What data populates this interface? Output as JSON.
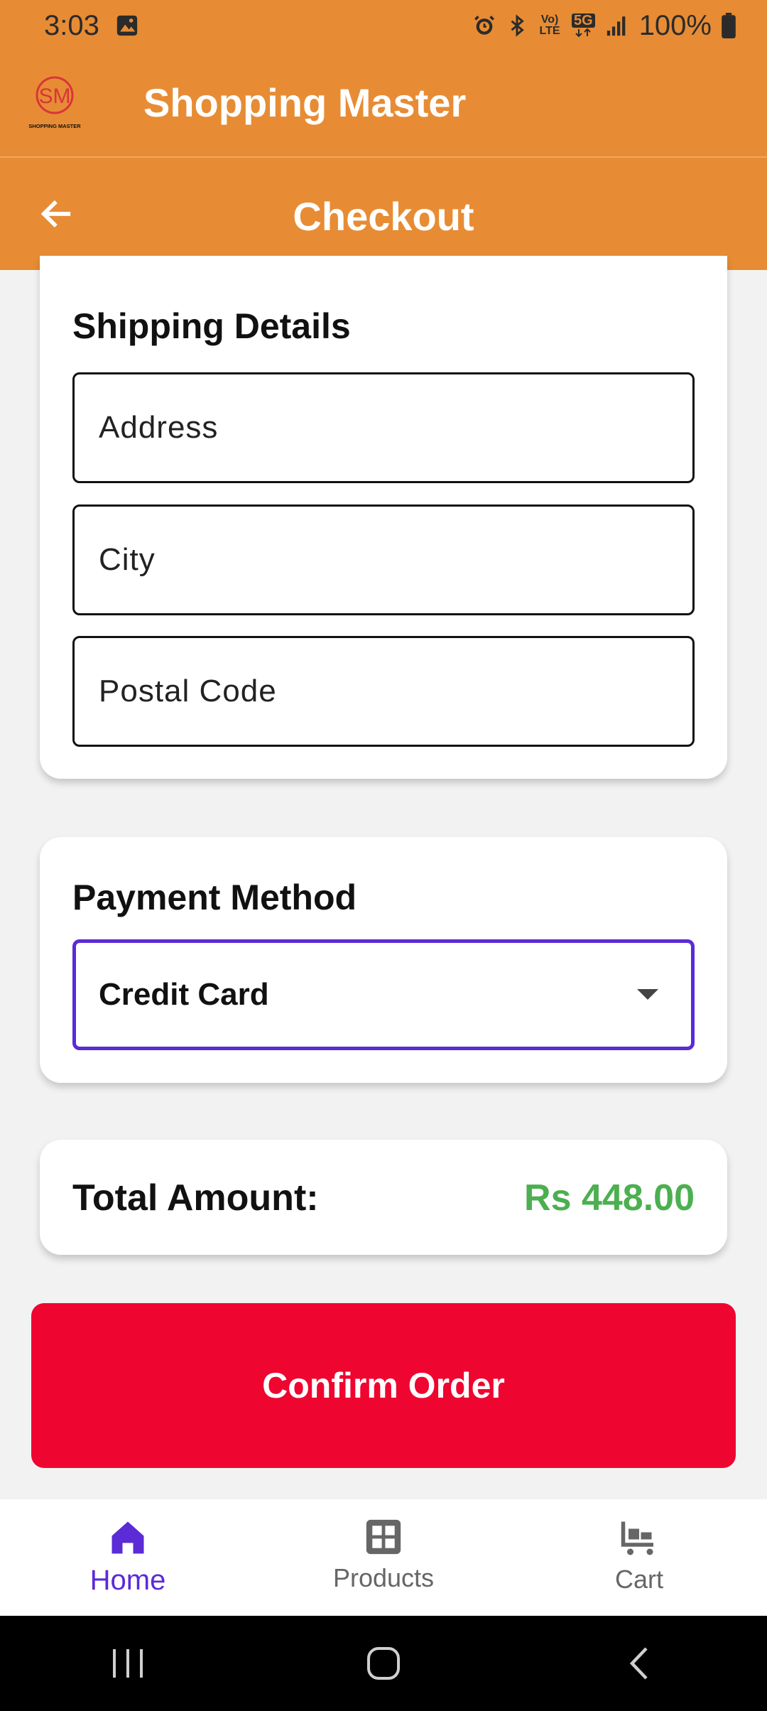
{
  "status_bar": {
    "time": "3:03",
    "battery": "100%",
    "network": "5G",
    "volte": "Vo) LTE",
    "icons": [
      "image-icon",
      "alarm-icon",
      "bluetooth-icon",
      "volte-icon",
      "5g-icon",
      "signal-icon",
      "battery-icon"
    ]
  },
  "app_bar": {
    "logo_text": "SM",
    "logo_caption": "SHOPPING MASTER",
    "title": "Shopping Master"
  },
  "checkout_bar": {
    "title": "Checkout",
    "back_icon": "arrow-left-icon"
  },
  "shipping": {
    "title": "Shipping Details",
    "address_placeholder": "Address",
    "city_placeholder": "City",
    "postal_placeholder": "Postal Code"
  },
  "payment": {
    "title": "Payment Method",
    "selected": "Credit Card",
    "dropdown_icon": "caret-down-icon"
  },
  "total": {
    "label": "Total Amount:",
    "value": "Rs 448.00",
    "value_color": "#4caf50"
  },
  "confirm": {
    "label": "Confirm Order",
    "color": "#ee0630"
  },
  "bottom_nav": {
    "items": [
      {
        "label": "Home",
        "icon": "home-icon",
        "active": true
      },
      {
        "label": "Products",
        "icon": "grid-icon",
        "active": false
      },
      {
        "label": "Cart",
        "icon": "cart-icon",
        "active": false
      }
    ]
  },
  "colors": {
    "primary_bar": "#e78c34",
    "accent": "#5b2bd6"
  }
}
